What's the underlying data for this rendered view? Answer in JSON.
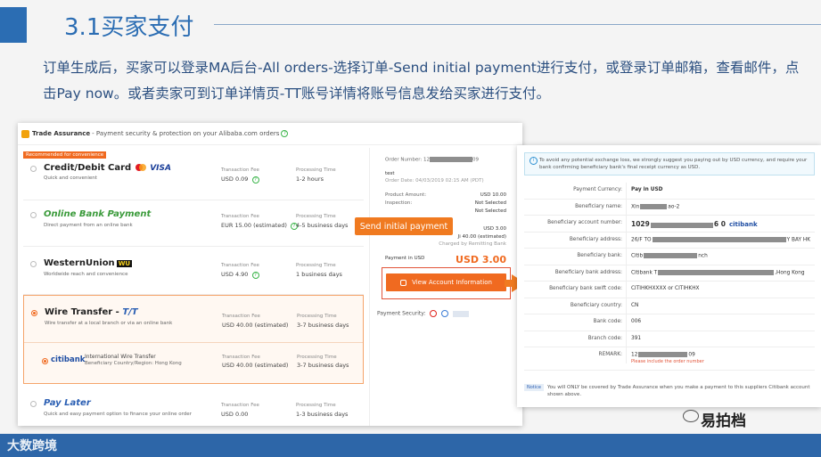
{
  "slide": {
    "title": "3.1买家支付",
    "paragraph": "订单生成后，买家可以登录MA后台-All orders-选择订单-Send initial payment进行支付，或登录订单邮箱，查看邮件，点击Pay now。或者卖家可到订单详情页-TT账号详情将账号信息发给买家进行支付。",
    "callout_button": "Send initial payment",
    "brand_bottom_left": "大数跨境",
    "watermark": "易拍档"
  },
  "payment_panel": {
    "header_title": "Trade Assurance",
    "header_desc": "- Payment security & protection on your Alibaba.com orders",
    "recommended_tag": "Recommended for convenience",
    "methods": [
      {
        "name": "Credit/Debit Card",
        "sub": "Quick and convenient",
        "fee_label": "Transaction Fee",
        "fee": "USD 0.09",
        "proc_label": "Processing Time",
        "proc": "1-2 hours",
        "brand": "VISA"
      },
      {
        "name": "Online Bank Payment",
        "sub": "Direct payment from an online bank",
        "fee_label": "Transaction Fee",
        "fee": "EUR 15.00 (estimated)",
        "proc_label": "Processing Time",
        "proc": "4-5 business days"
      },
      {
        "name": "WesternUnion",
        "brand": "WU",
        "sub": "Worldwide reach and convenience",
        "fee_label": "Transaction Fee",
        "fee": "USD 4.90",
        "proc_label": "Processing Time",
        "proc": "1 business days"
      },
      {
        "name": "Wire Transfer - ",
        "brand": "T/T",
        "sub": "Wire transfer at a local branch or via an online bank",
        "fee_label": "Transaction Fee",
        "fee": "USD 40.00 (estimated)",
        "proc_label": "Processing Time",
        "proc": "3-7 business days"
      },
      {
        "name": "Pay Later",
        "sub": "Quick and easy payment option to finance your online order",
        "fee_label": "Transaction Fee",
        "fee": "USD 0.00",
        "proc_label": "Processing Time",
        "proc": "1-3 business days"
      }
    ],
    "citi": {
      "logo": "citibank",
      "name": "International Wire Transfer",
      "sub": "Beneficiary Country/Region: Hong Kong",
      "fee_label": "Transaction Fee",
      "fee": "USD 40.00 (estimated)",
      "proc_label": "Processing Time",
      "proc": "3-7 business days"
    },
    "order": {
      "number_label": "Order Number: 12",
      "number_tail": "09",
      "test": "test",
      "date": "Order Date: 04/03/2019 02:15 AM (PDT)",
      "product_label": "Product Amount:",
      "product": "USD 10.00",
      "inspection_label": "Inspection:",
      "inspection": "Not Selected",
      "shipping": "Not Selected",
      "subtotal": "USD 3.00",
      "fee_line": "Ji 40.00 (estimated)",
      "charged": "Charged by Remitting Bank",
      "pay_label": "Payment in USD",
      "pay_total": "USD 3.00",
      "view_btn": "View Account Information",
      "security_label": "Payment Security:"
    }
  },
  "account_panel": {
    "notice_top": "To avoid any potential exchange loss, we strongly suggest you paying out by USD currency, and require your bank confirming beneficiary bank's final receipt currency as USD.",
    "rows": [
      {
        "k": "Payment Currency:",
        "v": "Pay in USD"
      },
      {
        "k": "Beneficiary name:",
        "v": "Xin",
        "v2": "ao-2"
      },
      {
        "k": "Beneficiary account number:",
        "v": "1029",
        "v2": "6 0",
        "v3": "citibank"
      },
      {
        "k": "Beneficiary address:",
        "v": "26/F TO",
        "v2": "Y BAY HK"
      },
      {
        "k": "Beneficiary bank:",
        "v": "Citib",
        "v2": "nch"
      },
      {
        "k": "Beneficiary bank address:",
        "v": "Citibank T",
        "v2": ",Hong Kong"
      },
      {
        "k": "Beneficiary bank swift code:",
        "v": "CITIHKHXXXX or CITIHKHX"
      },
      {
        "k": "Beneficiary country:",
        "v": "CN"
      },
      {
        "k": "Bank code:",
        "v": "006"
      },
      {
        "k": "Branch code:",
        "v": "391"
      },
      {
        "k": "REMARK:",
        "v": "12",
        "v2": "09",
        "note": "Please include the order number"
      }
    ],
    "notice_tag": "Notice",
    "notice_bottom": "You will ONLY be covered by Trade Assurance when you make a payment to this suppliers Citibank account shown above."
  },
  "colors": {
    "title": "#2b6db3",
    "accent": "#f06a20",
    "footer": "#2d66a8"
  }
}
